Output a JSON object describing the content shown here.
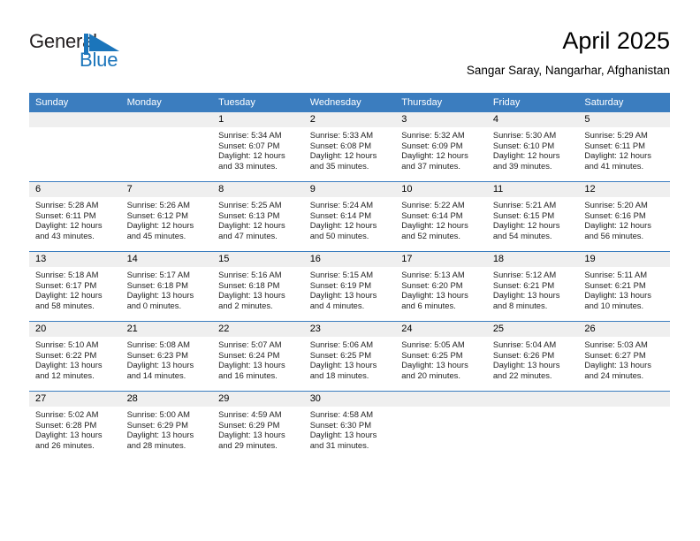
{
  "logo": {
    "word_top": "General",
    "word_bottom": "Blue",
    "mark": "blue-flag-triangle",
    "color_dark": "#231f20",
    "color_blue": "#1b75bb"
  },
  "header": {
    "month_title": "April 2025",
    "location": "Sangar Saray, Nangarhar, Afghanistan"
  },
  "theme": {
    "header_blue": "#3b7dbf",
    "daynum_band": "#efefef",
    "text": "#232323"
  },
  "labels": {
    "sunrise": "Sunrise:",
    "sunset": "Sunset:",
    "daylight": "Daylight:"
  },
  "weekdays": [
    "Sunday",
    "Monday",
    "Tuesday",
    "Wednesday",
    "Thursday",
    "Friday",
    "Saturday"
  ],
  "weeks": [
    [
      {
        "day": "",
        "empty": true
      },
      {
        "day": "",
        "empty": true
      },
      {
        "day": "1",
        "sunrise": "Sunrise: 5:34 AM",
        "sunset": "Sunset: 6:07 PM",
        "daylight": "Daylight: 12 hours and 33 minutes."
      },
      {
        "day": "2",
        "sunrise": "Sunrise: 5:33 AM",
        "sunset": "Sunset: 6:08 PM",
        "daylight": "Daylight: 12 hours and 35 minutes."
      },
      {
        "day": "3",
        "sunrise": "Sunrise: 5:32 AM",
        "sunset": "Sunset: 6:09 PM",
        "daylight": "Daylight: 12 hours and 37 minutes."
      },
      {
        "day": "4",
        "sunrise": "Sunrise: 5:30 AM",
        "sunset": "Sunset: 6:10 PM",
        "daylight": "Daylight: 12 hours and 39 minutes."
      },
      {
        "day": "5",
        "sunrise": "Sunrise: 5:29 AM",
        "sunset": "Sunset: 6:11 PM",
        "daylight": "Daylight: 12 hours and 41 minutes."
      }
    ],
    [
      {
        "day": "6",
        "sunrise": "Sunrise: 5:28 AM",
        "sunset": "Sunset: 6:11 PM",
        "daylight": "Daylight: 12 hours and 43 minutes."
      },
      {
        "day": "7",
        "sunrise": "Sunrise: 5:26 AM",
        "sunset": "Sunset: 6:12 PM",
        "daylight": "Daylight: 12 hours and 45 minutes."
      },
      {
        "day": "8",
        "sunrise": "Sunrise: 5:25 AM",
        "sunset": "Sunset: 6:13 PM",
        "daylight": "Daylight: 12 hours and 47 minutes."
      },
      {
        "day": "9",
        "sunrise": "Sunrise: 5:24 AM",
        "sunset": "Sunset: 6:14 PM",
        "daylight": "Daylight: 12 hours and 50 minutes."
      },
      {
        "day": "10",
        "sunrise": "Sunrise: 5:22 AM",
        "sunset": "Sunset: 6:14 PM",
        "daylight": "Daylight: 12 hours and 52 minutes."
      },
      {
        "day": "11",
        "sunrise": "Sunrise: 5:21 AM",
        "sunset": "Sunset: 6:15 PM",
        "daylight": "Daylight: 12 hours and 54 minutes."
      },
      {
        "day": "12",
        "sunrise": "Sunrise: 5:20 AM",
        "sunset": "Sunset: 6:16 PM",
        "daylight": "Daylight: 12 hours and 56 minutes."
      }
    ],
    [
      {
        "day": "13",
        "sunrise": "Sunrise: 5:18 AM",
        "sunset": "Sunset: 6:17 PM",
        "daylight": "Daylight: 12 hours and 58 minutes."
      },
      {
        "day": "14",
        "sunrise": "Sunrise: 5:17 AM",
        "sunset": "Sunset: 6:18 PM",
        "daylight": "Daylight: 13 hours and 0 minutes."
      },
      {
        "day": "15",
        "sunrise": "Sunrise: 5:16 AM",
        "sunset": "Sunset: 6:18 PM",
        "daylight": "Daylight: 13 hours and 2 minutes."
      },
      {
        "day": "16",
        "sunrise": "Sunrise: 5:15 AM",
        "sunset": "Sunset: 6:19 PM",
        "daylight": "Daylight: 13 hours and 4 minutes."
      },
      {
        "day": "17",
        "sunrise": "Sunrise: 5:13 AM",
        "sunset": "Sunset: 6:20 PM",
        "daylight": "Daylight: 13 hours and 6 minutes."
      },
      {
        "day": "18",
        "sunrise": "Sunrise: 5:12 AM",
        "sunset": "Sunset: 6:21 PM",
        "daylight": "Daylight: 13 hours and 8 minutes."
      },
      {
        "day": "19",
        "sunrise": "Sunrise: 5:11 AM",
        "sunset": "Sunset: 6:21 PM",
        "daylight": "Daylight: 13 hours and 10 minutes."
      }
    ],
    [
      {
        "day": "20",
        "sunrise": "Sunrise: 5:10 AM",
        "sunset": "Sunset: 6:22 PM",
        "daylight": "Daylight: 13 hours and 12 minutes."
      },
      {
        "day": "21",
        "sunrise": "Sunrise: 5:08 AM",
        "sunset": "Sunset: 6:23 PM",
        "daylight": "Daylight: 13 hours and 14 minutes."
      },
      {
        "day": "22",
        "sunrise": "Sunrise: 5:07 AM",
        "sunset": "Sunset: 6:24 PM",
        "daylight": "Daylight: 13 hours and 16 minutes."
      },
      {
        "day": "23",
        "sunrise": "Sunrise: 5:06 AM",
        "sunset": "Sunset: 6:25 PM",
        "daylight": "Daylight: 13 hours and 18 minutes."
      },
      {
        "day": "24",
        "sunrise": "Sunrise: 5:05 AM",
        "sunset": "Sunset: 6:25 PM",
        "daylight": "Daylight: 13 hours and 20 minutes."
      },
      {
        "day": "25",
        "sunrise": "Sunrise: 5:04 AM",
        "sunset": "Sunset: 6:26 PM",
        "daylight": "Daylight: 13 hours and 22 minutes."
      },
      {
        "day": "26",
        "sunrise": "Sunrise: 5:03 AM",
        "sunset": "Sunset: 6:27 PM",
        "daylight": "Daylight: 13 hours and 24 minutes."
      }
    ],
    [
      {
        "day": "27",
        "sunrise": "Sunrise: 5:02 AM",
        "sunset": "Sunset: 6:28 PM",
        "daylight": "Daylight: 13 hours and 26 minutes."
      },
      {
        "day": "28",
        "sunrise": "Sunrise: 5:00 AM",
        "sunset": "Sunset: 6:29 PM",
        "daylight": "Daylight: 13 hours and 28 minutes."
      },
      {
        "day": "29",
        "sunrise": "Sunrise: 4:59 AM",
        "sunset": "Sunset: 6:29 PM",
        "daylight": "Daylight: 13 hours and 29 minutes."
      },
      {
        "day": "30",
        "sunrise": "Sunrise: 4:58 AM",
        "sunset": "Sunset: 6:30 PM",
        "daylight": "Daylight: 13 hours and 31 minutes."
      },
      {
        "day": "",
        "empty": true
      },
      {
        "day": "",
        "empty": true
      },
      {
        "day": "",
        "empty": true
      }
    ]
  ]
}
